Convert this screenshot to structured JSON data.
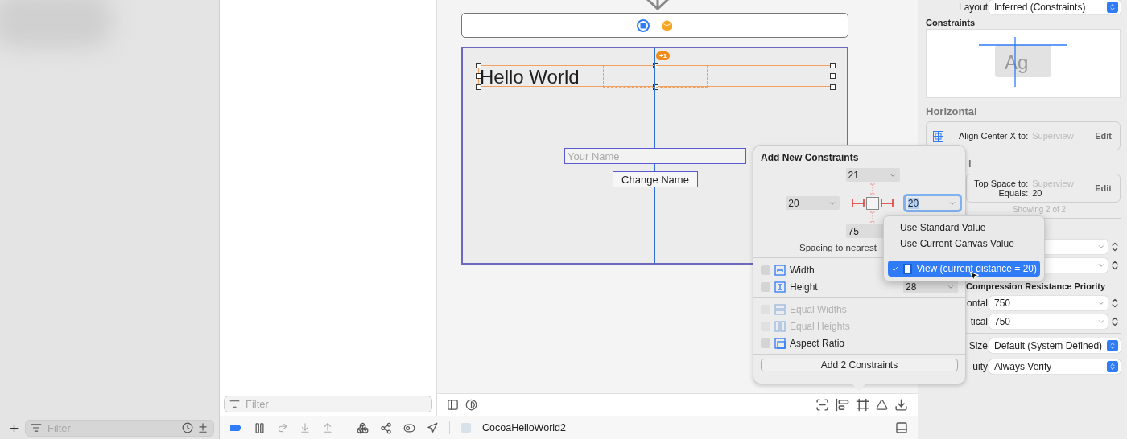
{
  "navigator": {
    "filter": {
      "placeholder": "Filter"
    }
  },
  "outline": {
    "filter": {
      "placeholder": "Filter"
    }
  },
  "canvas": {
    "scene": {
      "label": "Hello World",
      "badge": "+1",
      "text_field": {
        "placeholder": "Your Name"
      },
      "button": "Change Name"
    }
  },
  "popover": {
    "title": "Add New Constraints",
    "spacing": {
      "top": {
        "value": "21",
        "focused": false
      },
      "left": {
        "value": "20",
        "focused": false
      },
      "right": {
        "value": "20",
        "focused": true
      },
      "bottom": {
        "value": "75",
        "focused": false
      }
    },
    "spacing_label": "Spacing to nearest",
    "options": [
      {
        "kind": "width",
        "label": "Width",
        "checked": false,
        "disabled": false
      },
      {
        "kind": "height",
        "label": "Height",
        "checked": false,
        "disabled": false,
        "value": "28"
      },
      {
        "kind": "equal-widths",
        "label": "Equal Widths",
        "checked": false,
        "disabled": true
      },
      {
        "kind": "equal-heights",
        "label": "Equal Heights",
        "checked": false,
        "disabled": true
      },
      {
        "kind": "aspect",
        "label": "Aspect Ratio",
        "checked": false,
        "disabled": false
      }
    ],
    "button": "Add 2 Constraints"
  },
  "menu": {
    "items": [
      {
        "kind": "action",
        "label": "Use Standard Value",
        "selected": false
      },
      {
        "kind": "action",
        "label": "Use Current Canvas Value",
        "selected": false
      },
      {
        "kind": "view",
        "label": "View (current distance = 20)",
        "selected": true
      }
    ]
  },
  "inspector": {
    "layout": {
      "label": "Layout",
      "value": "Inferred (Constraints)"
    },
    "constraints_title": "Constraints",
    "preview_text": "Ag",
    "sections": [
      {
        "title": "Horizontal",
        "constraints": [
          {
            "icon": true,
            "lines": [
              {
                "label": "Align Center X to:",
                "value": "Superview"
              }
            ],
            "action": "Edit"
          }
        ]
      },
      {
        "title": "l",
        "constraints": [
          {
            "icon": false,
            "lines": [
              {
                "label": "Top Space to:",
                "value": "Superview"
              },
              {
                "label": "Equals:",
                "value": "20"
              }
            ],
            "action": "Edit"
          }
        ]
      }
    ],
    "showing": "Showing 2 of 2",
    "compression": {
      "title": "Compression Resistance Priority",
      "rows": [
        {
          "label": "ontal",
          "value": "750"
        },
        {
          "label": "tical",
          "value": "750"
        }
      ]
    },
    "fields": [
      {
        "label": "Size",
        "value": "Default (System Defined)"
      },
      {
        "label": "uity",
        "value": "Always Verify"
      }
    ]
  },
  "debug_bar": {
    "scheme": "CocoaHelloWorld2"
  }
}
